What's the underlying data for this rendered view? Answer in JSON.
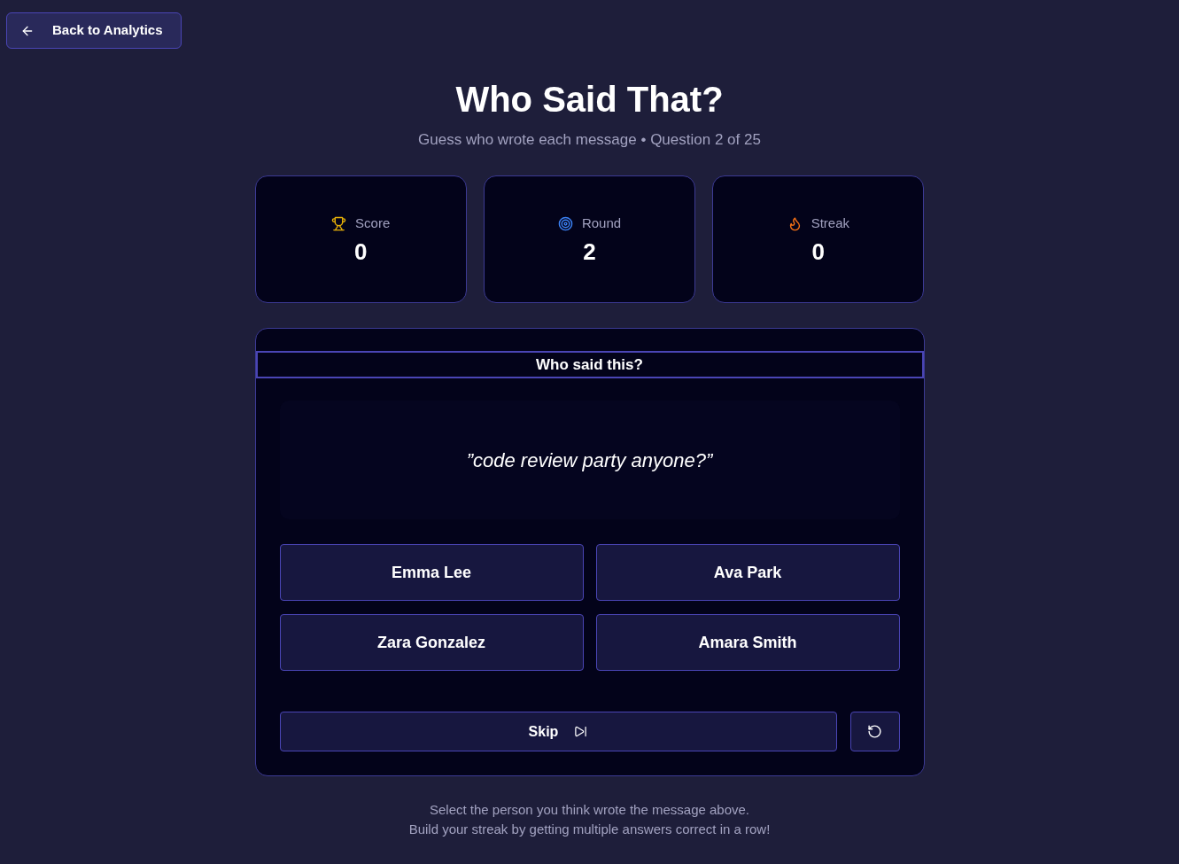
{
  "back_button": {
    "label": "Back to Analytics"
  },
  "header": {
    "title": "Who Said That?",
    "subtitle": "Guess who wrote each message • Question 2 of 25"
  },
  "stats": [
    {
      "kind": "trophy",
      "label": "Score",
      "value": "0"
    },
    {
      "kind": "target",
      "label": "Round",
      "value": "2"
    },
    {
      "kind": "flame",
      "label": "Streak",
      "value": "0"
    }
  ],
  "question": {
    "heading": "Who said this?",
    "quote": "”code review party anyone?”",
    "options": [
      "Emma Lee",
      "Ava Park",
      "Zara Gonzalez",
      "Amara Smith"
    ]
  },
  "actions": {
    "skip": "Skip"
  },
  "footer": [
    "Select the person you think wrote the message above.",
    "Build your streak by getting multiple answers correct in a row!"
  ]
}
